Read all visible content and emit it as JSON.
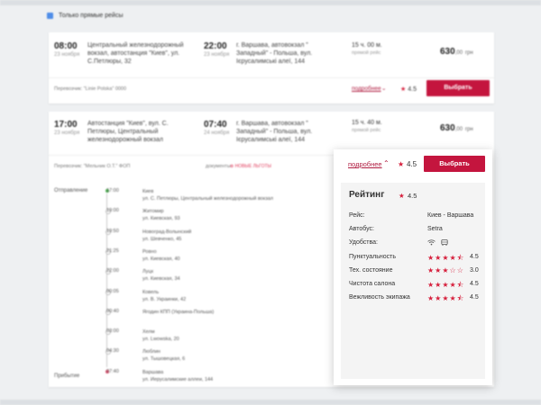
{
  "filter": {
    "label": "Только прямые рейсы"
  },
  "trips": [
    {
      "dep_time": "08:00",
      "dep_date": "23 ноября",
      "dep_station": [
        "Центральный железнодорожный",
        "вокзал, автостанция \"Киев\", ул.",
        "С.Петлюры, 32"
      ],
      "arr_time": "22:00",
      "arr_date": "23 ноября",
      "arr_station": [
        "г. Варшава, автовокзал \"",
        "Западный\" - Польша, вул.",
        "Ієрусалимські алеї, 144"
      ],
      "duration": "15 ч. 00 м.",
      "kind": "прямой рейс",
      "price": "630",
      "price_cents": ",00",
      "currency": "грн",
      "carrier": "Перевозчик: \"Linie Polska\" 0000",
      "more": "подробнее",
      "rating": "4.5",
      "select": "Выбрать"
    },
    {
      "dep_time": "17:00",
      "dep_date": "23 ноября",
      "dep_station": [
        "Автостанция \"Киев\", вул. С.",
        "Петлюры, Центральный",
        "железнодорожный вокзал"
      ],
      "arr_time": "07:40",
      "arr_date": "24 ноября",
      "arr_station": [
        "г. Варшава, автовокзал \"",
        "Западный\" - Польша, вул.",
        "Ієрусалимські алеї, 144"
      ],
      "duration": "15 ч. 40 м.",
      "kind": "прямой рейс",
      "price": "630",
      "price_cents": ",00",
      "currency": "грн",
      "carrier": "Перевозчик: \"Мельник О.Т.\" ФОП",
      "docs": "документы",
      "sticker": "НОВЫЕ ЛЬГОТЫ"
    }
  ],
  "route": {
    "departure_label": "Отправление",
    "arrival_label": "Прибытие",
    "stops": [
      {
        "time": "17:00",
        "name": "Киев",
        "addr": "ул. С. Петлюры, Центральный железнодорожный вокзал"
      },
      {
        "time": "19:00",
        "name": "Житомир",
        "addr": "ул. Киевская, 93"
      },
      {
        "time": "19:50",
        "name": "Новоград-Волынский",
        "addr": "ул. Шевченко, 45"
      },
      {
        "time": "21:25",
        "name": "Ровно",
        "addr": "ул. Киевская, 40"
      },
      {
        "time": "22:00",
        "name": "Луцк",
        "addr": "ул. Киевская, 34"
      },
      {
        "time": "00:05",
        "name": "Ковель",
        "addr": "ул. В. Украинки, 42"
      },
      {
        "time": "00:40",
        "name": "Ягодин КПП (Украина-Польша)",
        "addr": ""
      },
      {
        "time": "03:00",
        "name": "Хелм",
        "addr": "ул. Lwowska, 20"
      },
      {
        "time": "04:30",
        "name": "Люблин",
        "addr": "ул. Тышовецкая, 6"
      },
      {
        "time": "07:40",
        "name": "Варшава",
        "addr": "ул. Иерусалимские аллеи, 144"
      }
    ]
  },
  "popup": {
    "more": "подробнее",
    "rating": "4.5",
    "select": "Выбрать",
    "title": "Рейтинг",
    "title_rating": "4.5",
    "trip_label": "Рейс:",
    "trip_value": "Киев - Варшава",
    "bus_label": "Автобус:",
    "bus_value": "Setra",
    "amenities_label": "Удобства:",
    "amenities_icons": [
      "wifi-icon",
      "bus-icon"
    ],
    "scores": [
      {
        "label": "Пунктуальность",
        "value": "4.5",
        "stars": 4.5
      },
      {
        "label": "Тех. состояние",
        "value": "3.0",
        "stars": 3
      },
      {
        "label": "Чистота салона",
        "value": "4.5",
        "stars": 4.5
      },
      {
        "label": "Вежливость экипажа",
        "value": "4.5",
        "stars": 4.5
      }
    ]
  },
  "colors": {
    "accent": "#c4153e",
    "star": "#d61f3c",
    "checkbox": "#4f8de8"
  }
}
